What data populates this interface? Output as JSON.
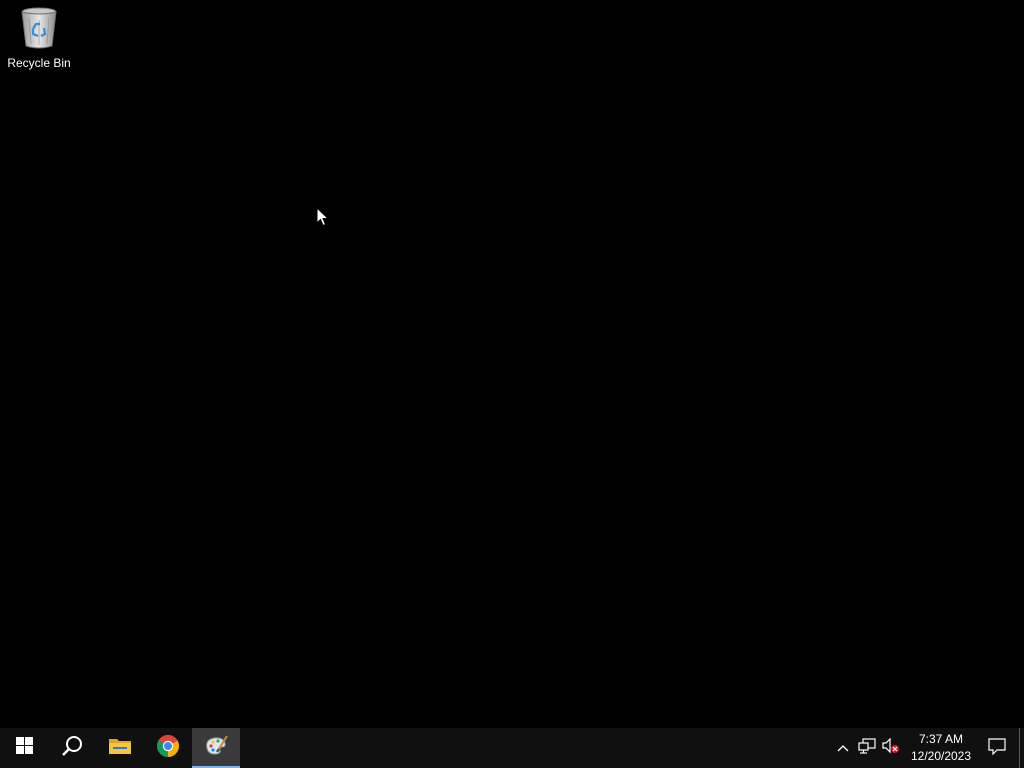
{
  "desktop": {
    "background_color": "#000000",
    "icons": [
      {
        "label": "Recycle Bin",
        "icon": "recycle-bin-icon"
      }
    ]
  },
  "taskbar": {
    "background_color": "#101010",
    "accent_color": "#7fb4e8",
    "items": [
      {
        "name": "start",
        "icon": "windows-logo-icon",
        "active": false
      },
      {
        "name": "search",
        "icon": "search-icon",
        "active": false
      },
      {
        "name": "file-explorer",
        "icon": "folder-icon",
        "active": false
      },
      {
        "name": "chrome",
        "icon": "chrome-icon",
        "active": false
      },
      {
        "name": "paint",
        "icon": "paint-palette-icon",
        "active": true
      }
    ]
  },
  "tray": {
    "icons": [
      "chevron-up-icon",
      "network-icon",
      "volume-muted-icon"
    ],
    "time": "7:37 AM",
    "date": "12/20/2023",
    "notification_icon": "action-center-icon"
  }
}
